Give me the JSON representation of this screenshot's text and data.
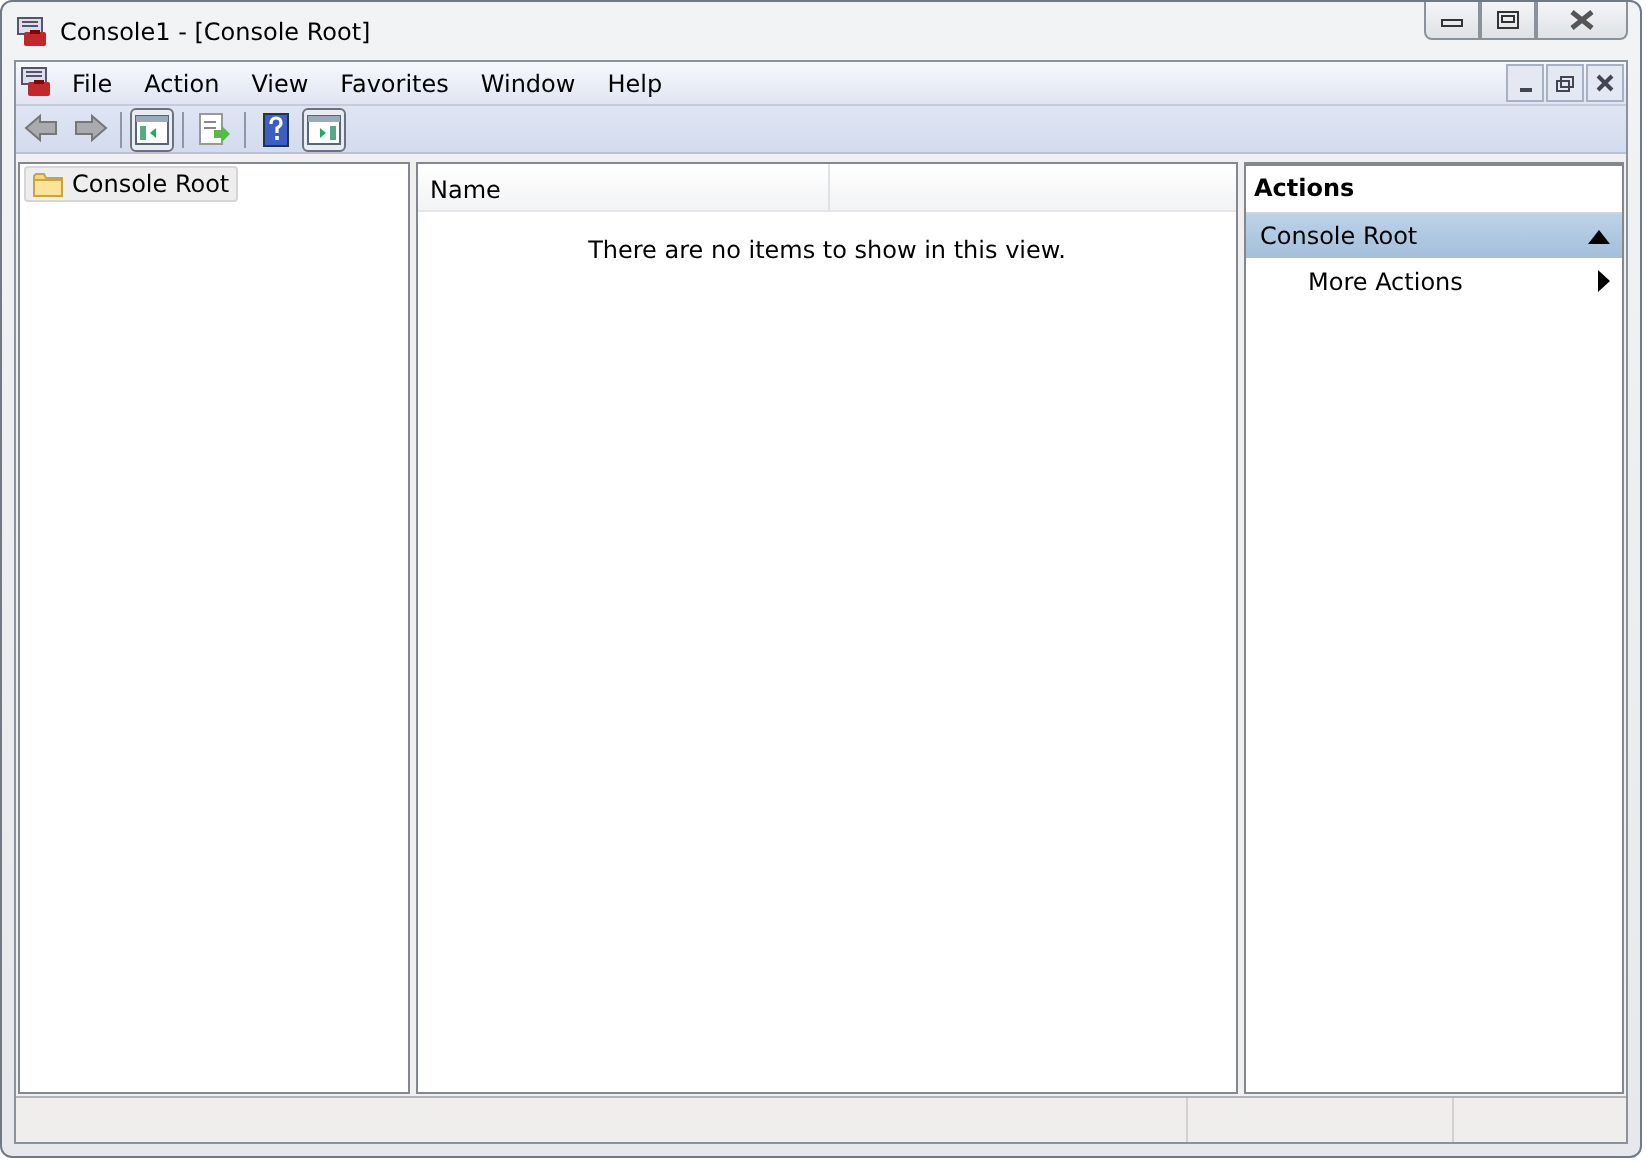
{
  "window": {
    "title": "Console1 - [Console Root]"
  },
  "menu": [
    {
      "label": "File"
    },
    {
      "label": "Action"
    },
    {
      "label": "View"
    },
    {
      "label": "Favorites"
    },
    {
      "label": "Window"
    },
    {
      "label": "Help"
    }
  ],
  "toolbar": [
    {
      "kind": "back",
      "pressed": false
    },
    {
      "kind": "forward",
      "pressed": false
    },
    {
      "kind": "sep"
    },
    {
      "kind": "tree-toggle",
      "pressed": true
    },
    {
      "kind": "sep"
    },
    {
      "kind": "export",
      "pressed": false
    },
    {
      "kind": "sep"
    },
    {
      "kind": "help",
      "pressed": false
    },
    {
      "kind": "action-toggle",
      "pressed": true
    }
  ],
  "tree": [
    {
      "label": "Console Root",
      "selected": true
    }
  ],
  "list": {
    "columns": [
      "Name"
    ],
    "empty_message": "There are no items to show in this view."
  },
  "actions": {
    "title": "Actions",
    "sections": [
      {
        "title": "Console Root",
        "expanded": true,
        "items": [
          {
            "label": "More Actions",
            "submenu": true
          }
        ]
      }
    ]
  }
}
